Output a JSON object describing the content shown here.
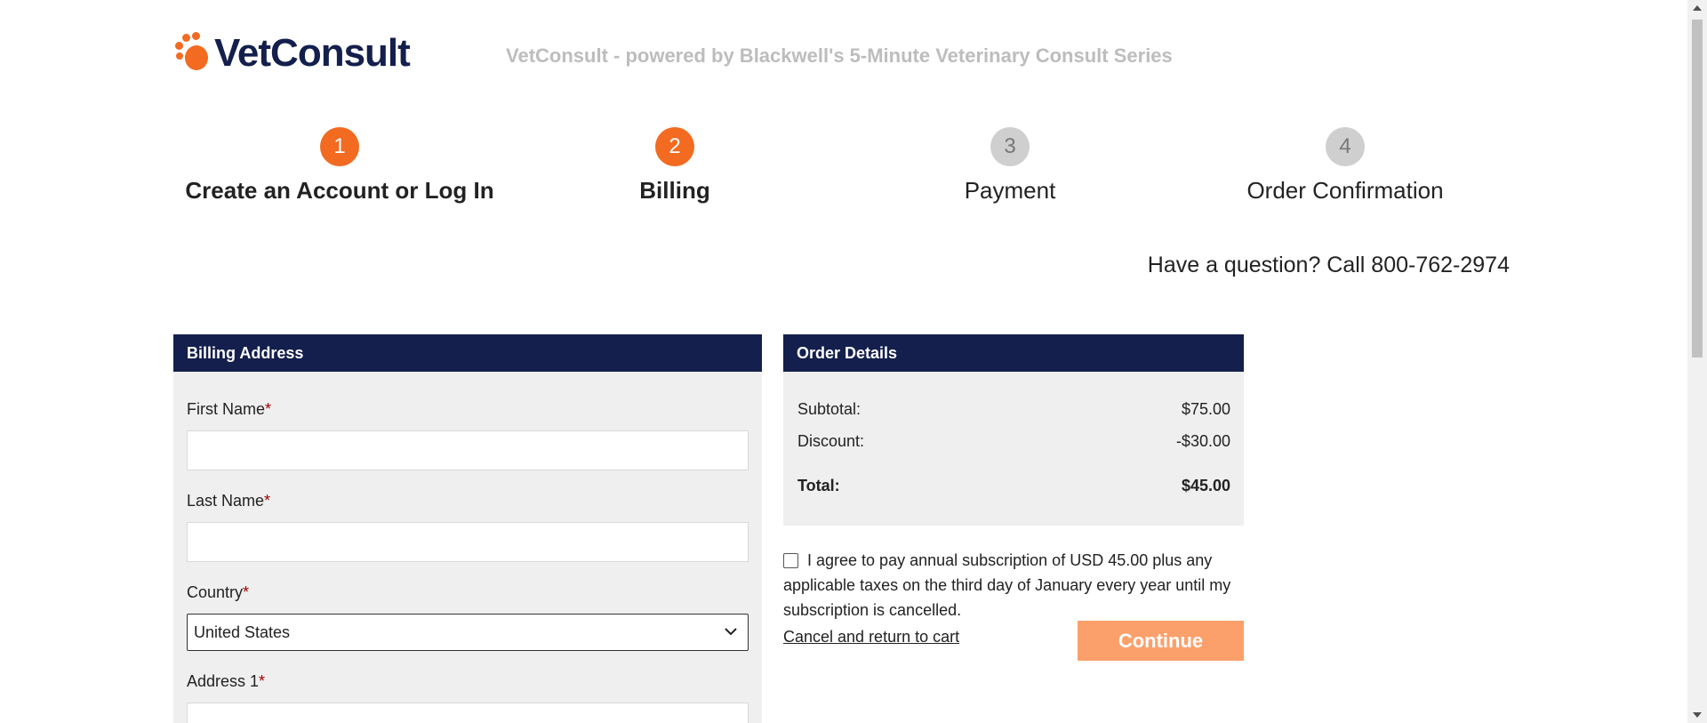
{
  "header": {
    "logo_text": "VetConsult",
    "tagline": "VetConsult - powered by Blackwell's 5-Minute Veterinary Consult Series"
  },
  "steps": [
    {
      "number": "1",
      "label": "Create an Account or Log In",
      "state": "done"
    },
    {
      "number": "2",
      "label": "Billing",
      "state": "current"
    },
    {
      "number": "3",
      "label": "Payment",
      "state": "upcoming"
    },
    {
      "number": "4",
      "label": "Order Confirmation",
      "state": "upcoming"
    }
  ],
  "question": "Have a question? Call 800-762-2974",
  "billing": {
    "heading": "Billing Address",
    "first_name_label": "First Name",
    "last_name_label": "Last Name",
    "country_label": "Country",
    "country_value": "United States",
    "address1_label": "Address 1",
    "required_mark": "*"
  },
  "order": {
    "heading": "Order Details",
    "subtotal_label": "Subtotal:",
    "subtotal_value": "$75.00",
    "discount_label": "Discount:",
    "discount_value": "-$30.00",
    "total_label": "Total:",
    "total_value": "$45.00"
  },
  "agree_text": "I agree to pay annual subscription of USD 45.00 plus any applicable taxes on the third day of January every year until my subscription is cancelled.",
  "cancel_link": "Cancel and return to cart",
  "continue_label": "Continue",
  "colors": {
    "brand_orange": "#f26b21",
    "navy": "#141f4d",
    "continue_disabled": "#fca06b"
  }
}
